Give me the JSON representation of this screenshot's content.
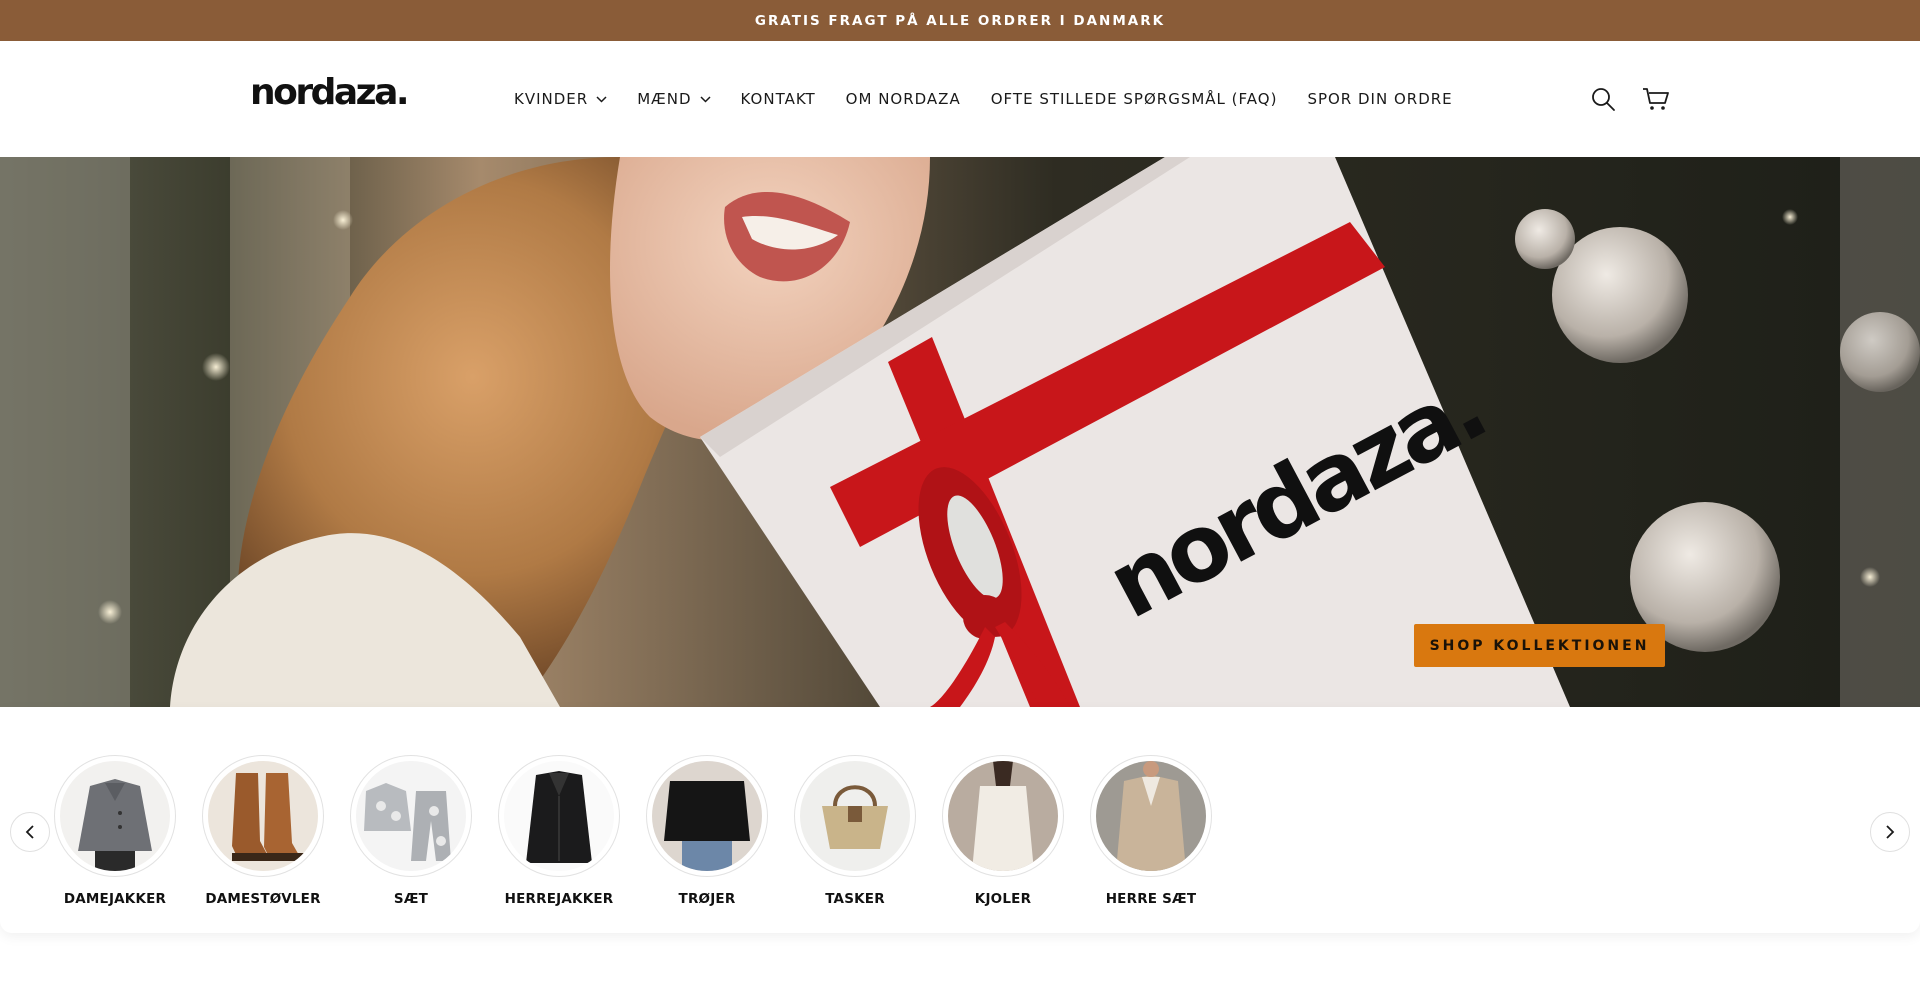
{
  "announcement": {
    "text": "GRATIS FRAGT PÅ ALLE ORDRER I DANMARK"
  },
  "header": {
    "logo": "nordaza.",
    "nav": [
      {
        "label": "KVINDER",
        "dropdown": true
      },
      {
        "label": "MÆND",
        "dropdown": true
      },
      {
        "label": "KONTAKT",
        "dropdown": false
      },
      {
        "label": "OM NORDAZA",
        "dropdown": false
      },
      {
        "label": "OFTE STILLEDE SPØRGSMÅL (FAQ)",
        "dropdown": false
      },
      {
        "label": "SPOR DIN ORDRE",
        "dropdown": false
      }
    ],
    "icons": [
      "search-icon",
      "cart-icon"
    ]
  },
  "hero": {
    "box_brand": "nordaza.",
    "cta_label": "SHOP KOLLEKTIONEN"
  },
  "categories": {
    "items": [
      {
        "label": "DAMEJAKKER"
      },
      {
        "label": "DAMESTØVLER"
      },
      {
        "label": "SÆT"
      },
      {
        "label": "HERREJAKKER"
      },
      {
        "label": "TRØJER"
      },
      {
        "label": "TASKER"
      },
      {
        "label": "KJOLER"
      },
      {
        "label": "HERRE SÆT"
      }
    ],
    "prev_icon": "chevron-left-icon",
    "next_icon": "chevron-right-icon"
  },
  "colors": {
    "announcement_bg": "#8a5c38",
    "cta_bg": "#d9780f"
  }
}
